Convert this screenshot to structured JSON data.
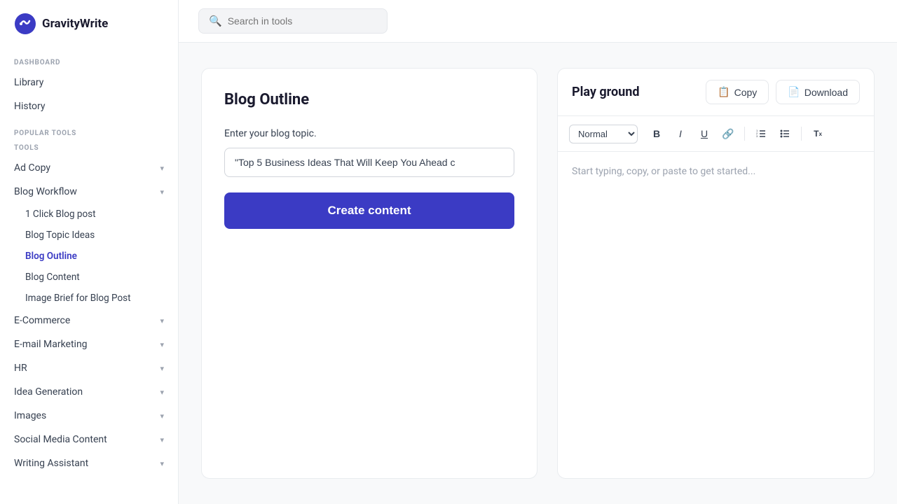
{
  "logo": {
    "text": "GravityWrite"
  },
  "search": {
    "placeholder": "Search in tools"
  },
  "sidebar": {
    "dashboard_label": "DASHBOARD",
    "library": "Library",
    "history": "History",
    "popular_tools_label": "POPULAR TOOLS",
    "tools_label": "TOOLS",
    "nav_items": [
      {
        "id": "ad-copy",
        "label": "Ad Copy",
        "expandable": true
      },
      {
        "id": "blog-workflow",
        "label": "Blog Workflow",
        "expandable": true,
        "expanded": true
      },
      {
        "id": "e-commerce",
        "label": "E-Commerce",
        "expandable": true
      },
      {
        "id": "email-marketing",
        "label": "E-mail Marketing",
        "expandable": true
      },
      {
        "id": "hr",
        "label": "HR",
        "expandable": true
      },
      {
        "id": "idea-generation",
        "label": "Idea Generation",
        "expandable": true
      },
      {
        "id": "images",
        "label": "Images",
        "expandable": true
      },
      {
        "id": "social-media",
        "label": "Social Media Content",
        "expandable": true
      },
      {
        "id": "writing-assistant",
        "label": "Writing Assistant",
        "expandable": true
      }
    ],
    "blog_workflow_subitems": [
      {
        "id": "1-click-blog",
        "label": "1 Click Blog post"
      },
      {
        "id": "blog-topic-ideas",
        "label": "Blog Topic Ideas"
      },
      {
        "id": "blog-outline",
        "label": "Blog Outline",
        "active": true
      },
      {
        "id": "blog-content",
        "label": "Blog Content"
      },
      {
        "id": "image-brief",
        "label": "Image Brief for Blog Post"
      }
    ]
  },
  "left_panel": {
    "title": "Blog Outline",
    "input_label": "Enter your blog topic.",
    "input_value": "\"Top 5 Business Ideas That Will Keep You Ahead c",
    "input_placeholder": "",
    "create_btn": "Create content"
  },
  "right_panel": {
    "title": "Play ground",
    "copy_btn": "Copy",
    "download_btn": "Download",
    "toolbar": {
      "style_select": "Normal",
      "bold": "B",
      "italic": "I",
      "underline": "U",
      "link": "🔗",
      "ordered_list": "≡",
      "unordered_list": "☰",
      "clear": "Tx"
    },
    "placeholder": "Start typing, copy, or paste to get started..."
  }
}
